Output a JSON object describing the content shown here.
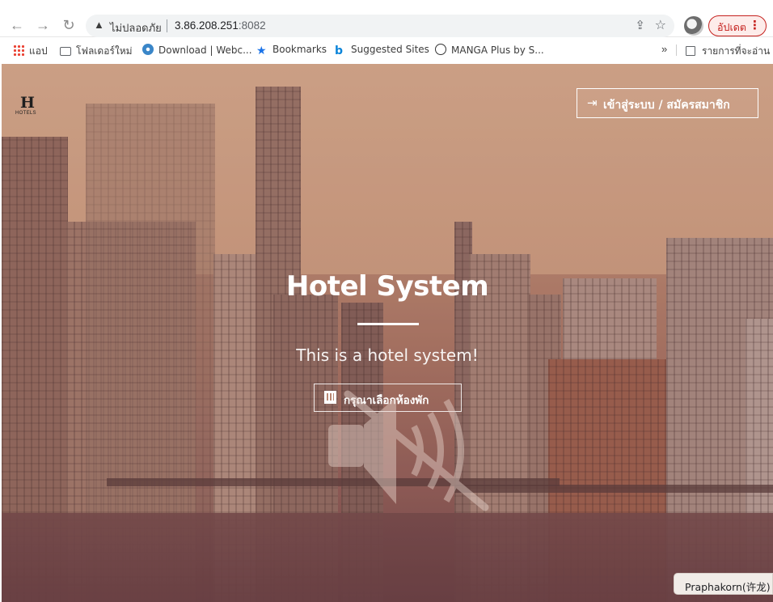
{
  "browser": {
    "security_label": "ไม่ปลอดภัย",
    "url_host": "3.86.208.251",
    "url_port": ":8082",
    "update_label": "อัปเดต"
  },
  "bookmarks": {
    "items": [
      {
        "label": "แอป",
        "icon": "apps-grid-icon"
      },
      {
        "label": "โฟลเดอร์ใหม่",
        "icon": "folder-icon"
      },
      {
        "label": "Download | Webc...",
        "icon": "webcam-icon"
      },
      {
        "label": "Bookmarks",
        "icon": "star-icon"
      },
      {
        "label": "Suggested Sites",
        "icon": "bing-icon"
      },
      {
        "label": "MANGA Plus by S...",
        "icon": "manga-icon"
      }
    ],
    "more": "»",
    "reading_list": "รายการที่จะอ่าน"
  },
  "page": {
    "logo_text": "HOTELS",
    "login_label": "เข้าสู่ระบบ / สมัครสมาชิก",
    "hero_title": "Hotel System",
    "hero_subtitle": "This is a hotel system!",
    "rooms_label": "กรุณาเลือกห้องพัก"
  },
  "tooltip": {
    "label": "Praphakorn(许龙)"
  },
  "colors": {
    "update_accent": "#c5221f",
    "hero_tint": "#bd8d74",
    "text_on_hero": "#ffffff"
  }
}
